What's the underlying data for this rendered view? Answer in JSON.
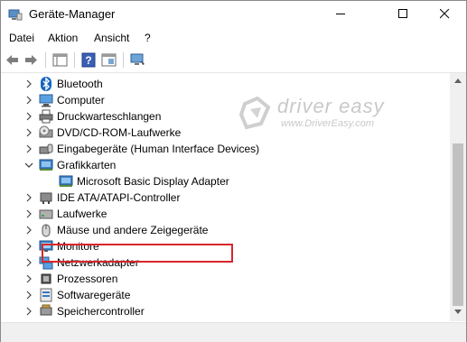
{
  "window": {
    "title": "Geräte-Manager"
  },
  "menu": [
    "Datei",
    "Aktion",
    "Ansicht",
    "?"
  ],
  "tree": {
    "items": [
      {
        "label": "Bluetooth",
        "icon": "bluetooth-icon",
        "expanded": false
      },
      {
        "label": "Computer",
        "icon": "computer-icon",
        "expanded": false
      },
      {
        "label": "Druckwarteschlangen",
        "icon": "printer-icon",
        "expanded": false
      },
      {
        "label": "DVD/CD-ROM-Laufwerke",
        "icon": "dvd-drive-icon",
        "expanded": false
      },
      {
        "label": "Eingabegeräte (Human Interface Devices)",
        "icon": "hid-icon",
        "expanded": false
      },
      {
        "label": "Grafikkarten",
        "icon": "display-adapter-icon",
        "expanded": true
      },
      {
        "label": "Microsoft Basic Display Adapter",
        "icon": "display-adapter-icon",
        "child": true
      },
      {
        "label": "IDE ATA/ATAPI-Controller",
        "icon": "ide-controller-icon",
        "expanded": false
      },
      {
        "label": "Laufwerke",
        "icon": "disk-drive-icon",
        "expanded": false
      },
      {
        "label": "Mäuse und andere Zeigegeräte",
        "icon": "mouse-icon",
        "expanded": false
      },
      {
        "label": "Monitore",
        "icon": "monitor-icon",
        "expanded": false
      },
      {
        "label": "Netzwerkadapter",
        "icon": "network-adapter-icon",
        "expanded": false
      },
      {
        "label": "Prozessoren",
        "icon": "processor-icon",
        "expanded": false
      },
      {
        "label": "Softwaregeräte",
        "icon": "software-device-icon",
        "expanded": false
      },
      {
        "label": "Speichercontroller",
        "icon": "storage-controller-icon",
        "expanded": false
      }
    ]
  },
  "watermark": {
    "brand": "driver easy",
    "url": "www.DriverEasy.com"
  },
  "colors": {
    "highlight_border": "#d9262b",
    "watermark": "#c9c9c9"
  }
}
